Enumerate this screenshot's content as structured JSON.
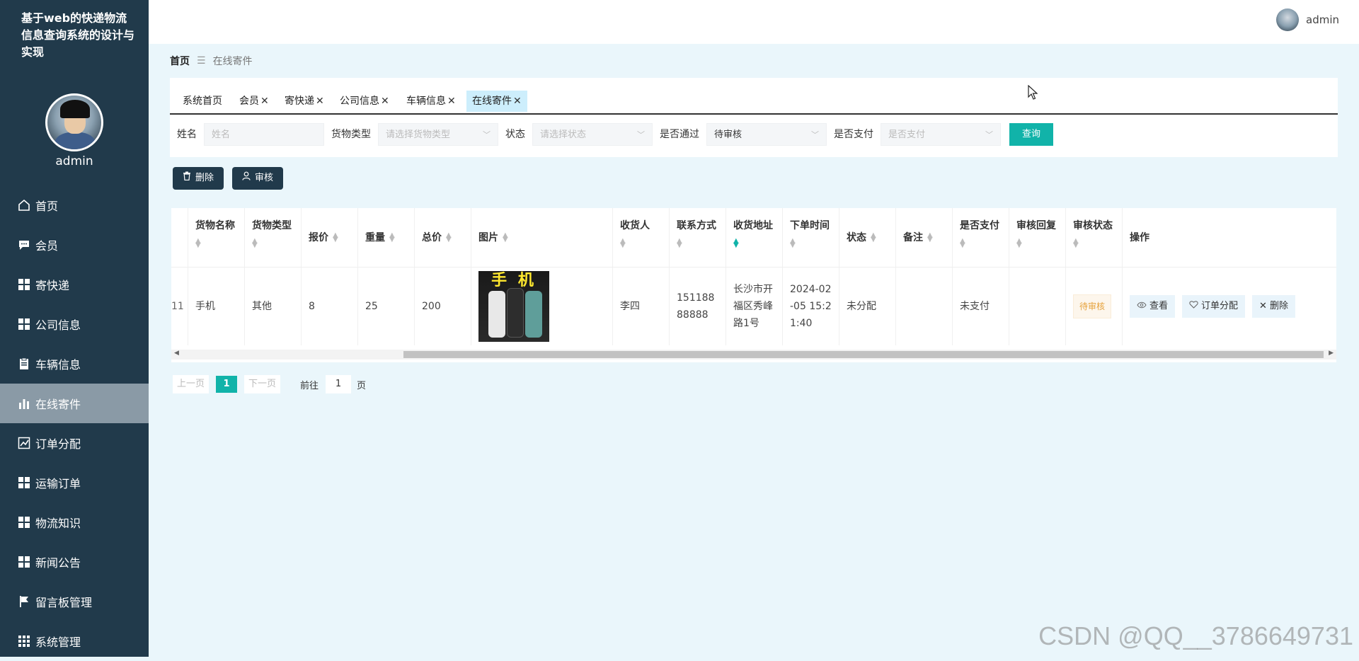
{
  "sidebar": {
    "title": "基于web的快递物流信息查询系统的设计与实现",
    "username": "admin",
    "items": [
      {
        "label": "首页",
        "icon": "home-icon"
      },
      {
        "label": "会员",
        "icon": "chat-icon"
      },
      {
        "label": "寄快递",
        "icon": "grid-icon"
      },
      {
        "label": "公司信息",
        "icon": "grid-icon"
      },
      {
        "label": "车辆信息",
        "icon": "clipboard-icon"
      },
      {
        "label": "在线寄件",
        "icon": "bar-chart-icon",
        "active": true
      },
      {
        "label": "订单分配",
        "icon": "line-chart-icon"
      },
      {
        "label": "运输订单",
        "icon": "grid-icon"
      },
      {
        "label": "物流知识",
        "icon": "grid-icon"
      },
      {
        "label": "新闻公告",
        "icon": "grid-icon"
      },
      {
        "label": "留言板管理",
        "icon": "flag-icon"
      },
      {
        "label": "系统管理",
        "icon": "apps-icon"
      }
    ]
  },
  "header": {
    "username": "admin"
  },
  "breadcrumb": {
    "home": "首页",
    "separator": "☰",
    "current": "在线寄件"
  },
  "tabs": [
    {
      "label": "系统首页",
      "closable": false
    },
    {
      "label": "会员",
      "closable": true
    },
    {
      "label": "寄快递",
      "closable": true
    },
    {
      "label": "公司信息",
      "closable": true
    },
    {
      "label": "车辆信息",
      "closable": true
    },
    {
      "label": "在线寄件",
      "closable": true,
      "active": true
    }
  ],
  "filters": {
    "name_label": "姓名",
    "name_placeholder": "姓名",
    "goods_type_label": "货物类型",
    "goods_type_placeholder": "请选择货物类型",
    "status_label": "状态",
    "status_placeholder": "请选择状态",
    "passed_label": "是否通过",
    "passed_value": "待审核",
    "paid_label": "是否支付",
    "paid_placeholder": "是否支付",
    "query_label": "查询"
  },
  "actions": {
    "delete_label": "删除",
    "audit_label": "审核"
  },
  "table": {
    "columns": [
      "货物名称",
      "货物类型",
      "报价",
      "重量",
      "总价",
      "图片",
      "收货人",
      "联系方式",
      "收货地址",
      "下单时间",
      "状态",
      "备注",
      "是否支付",
      "审核回复",
      "审核状态",
      "操作"
    ],
    "partial_first_cell": "11",
    "rows": [
      {
        "name": "手机",
        "type": "其他",
        "quote": "8",
        "weight": "25",
        "total": "200",
        "image_text": "手 机",
        "receiver": "李四",
        "phone": "15118888888",
        "address": "长沙市开福区秀峰路1号",
        "order_time": "2024-02-05 15:21:40",
        "status": "未分配",
        "remark": "",
        "paid": "未支付",
        "audit_reply": "",
        "audit_status": "待审核",
        "ops": [
          "查看",
          "订单分配",
          "删除"
        ]
      }
    ]
  },
  "pagination": {
    "prev": "上一页",
    "current": "1",
    "next": "下一页",
    "goto_label": "前往",
    "goto_value": "1",
    "unit": "页"
  },
  "watermark": "CSDN @QQ__3786649731",
  "colors": {
    "sidebar_bg": "#213a4b",
    "accent": "#11b3a9",
    "page_bg": "#eaf6fb",
    "active_tab_bg": "#cdeefc"
  }
}
